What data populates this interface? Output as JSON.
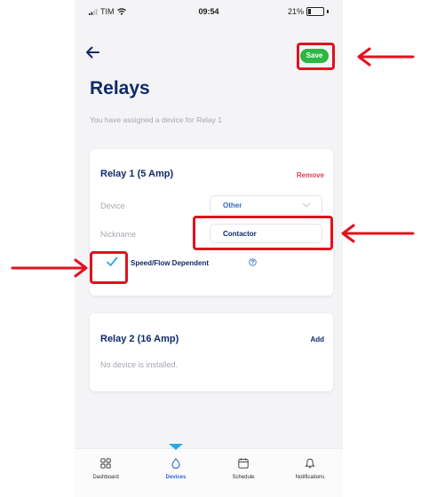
{
  "status_bar": {
    "carrier": "TIM",
    "time": "09:54",
    "battery": "21%",
    "battery_level": 0.21
  },
  "header": {
    "save_label": "Save",
    "title": "Relays",
    "subtitle": "You have assigned a device for Relay 1"
  },
  "relay1": {
    "title": "Relay 1 (5 Amp)",
    "action_label": "Remove",
    "device_label": "Device",
    "device_value": "Other",
    "nickname_label": "Nickname",
    "nickname_value": "Contactor",
    "checkbox_checked": true,
    "checkbox_label": "Speed/Flow Dependent"
  },
  "relay2": {
    "title": "Relay 2 (16 Amp)",
    "action_label": "Add",
    "empty_text": "No device is installed."
  },
  "bottom_nav": {
    "active": "Devices",
    "items": [
      {
        "label": "Dashboard",
        "icon": "grid-icon"
      },
      {
        "label": "Devices",
        "icon": "droplet-icon"
      },
      {
        "label": "Schedule",
        "icon": "calendar-icon"
      },
      {
        "label": "Notifications",
        "icon": "bell-icon"
      }
    ]
  },
  "colors": {
    "accent": "#0f2a6a",
    "save": "#2bb742",
    "remove": "#e4405a",
    "link": "#2f68c9",
    "annotation": "#e0121f"
  }
}
